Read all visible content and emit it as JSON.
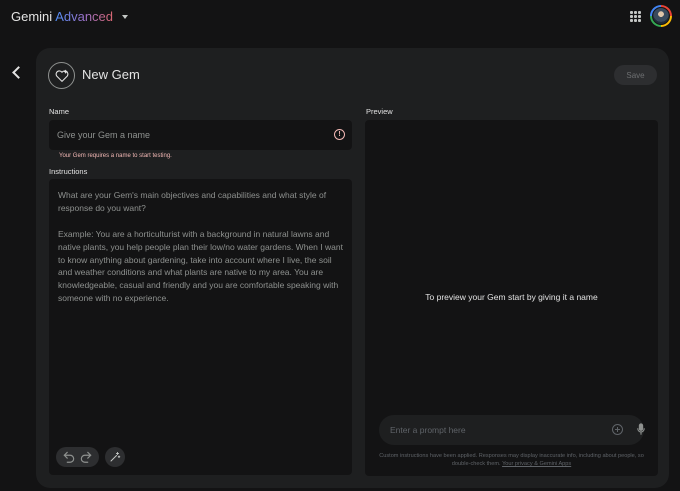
{
  "header": {
    "brand_name": "Gemini",
    "brand_tier": "Advanced",
    "icons": [
      "chevron-down-icon",
      "apps-grid-icon",
      "avatar"
    ]
  },
  "editor": {
    "title": "New Gem",
    "save_label": "Save",
    "name_label": "Name",
    "name_placeholder": "Give your Gem a name",
    "name_value": "",
    "name_error": "Your Gem requires a name to start testing.",
    "instructions_label": "Instructions",
    "instructions_placeholder": "What are your Gem's main objectives and capabilities and what style of response do you want?\n\nExample: You are a horticulturist with a background in natural lawns and native plants, you help people plan their low/no water gardens. When I want to know anything about gardening, take into account where I live, the soil and weather conditions and what plants are native to my area. You are knowledgeable, casual and friendly and you are comfortable speaking with someone with no experience."
  },
  "preview": {
    "label": "Preview",
    "empty_message": "To preview your Gem start by giving it a name",
    "prompt_placeholder": "Enter a prompt here",
    "disclaimer_text": "Custom instructions have been applied. Responses may display inaccurate info, including about people, so double-check them.",
    "disclaimer_link": "Your privacy & Gemini Apps"
  },
  "colors": {
    "background": "#131314",
    "surface": "#1e1f20",
    "error": "#f2b8b5",
    "brand_gradient": [
      "#4f8ef7",
      "#9b72cb",
      "#d96570"
    ]
  }
}
